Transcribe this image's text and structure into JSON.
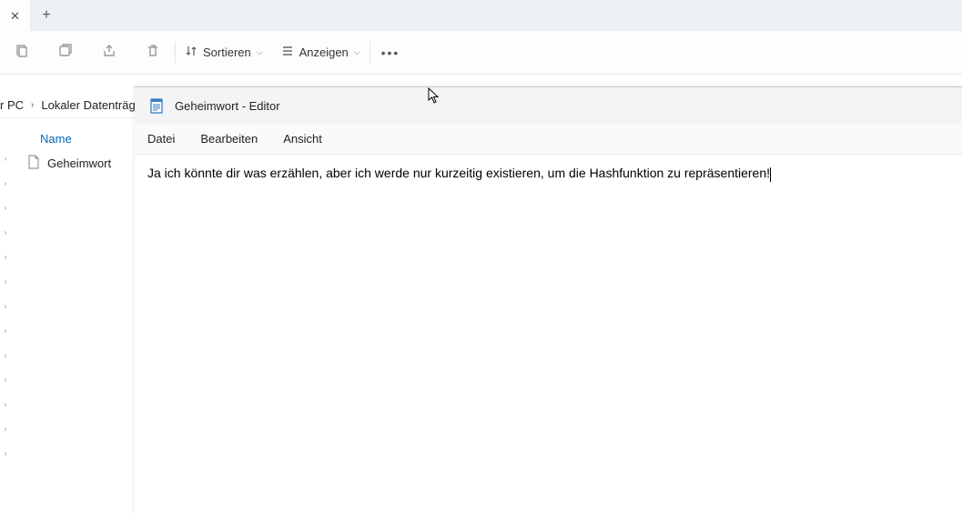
{
  "tabs": {
    "new_tab_tooltip": "Neuer Tab"
  },
  "toolbar": {
    "sort_label": "Sortieren",
    "view_label": "Anzeigen"
  },
  "breadcrumb": {
    "items": [
      "r PC",
      "Lokaler Datenträger"
    ]
  },
  "list": {
    "header_name": "Name",
    "files": [
      {
        "name": "Geheimwort"
      }
    ]
  },
  "notepad": {
    "title": "Geheimwort - Editor",
    "menu": {
      "file": "Datei",
      "edit": "Bearbeiten",
      "view": "Ansicht"
    },
    "content": "Ja ich könnte dir was erzählen, aber ich werde nur kurzeitig existieren, um die Hashfunktion zu repräsentieren!"
  }
}
